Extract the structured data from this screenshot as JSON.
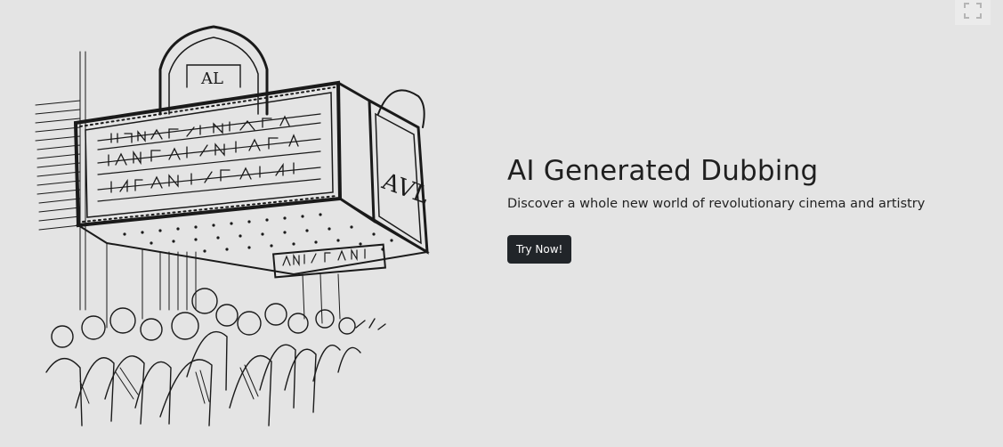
{
  "hero": {
    "title": "AI Generated Dubbing",
    "subtitle": "Discover a whole new world of revolutionary cinema and artistry",
    "cta_label": "Try Now!"
  },
  "illustration": {
    "description_icon": "theater-marquee-illustration"
  },
  "controls": {
    "fullscreen_icon": "fullscreen-icon"
  },
  "colors": {
    "background": "#e4e4e4",
    "button": "#212529",
    "button_text": "#ffffff"
  }
}
